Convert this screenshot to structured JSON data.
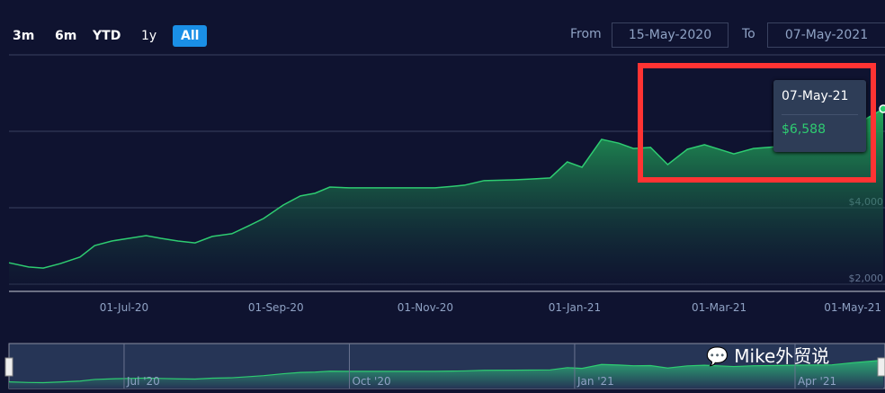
{
  "range_buttons": [
    {
      "label": "3m"
    },
    {
      "label": "6m"
    },
    {
      "label": "YTD"
    },
    {
      "label": "1y"
    },
    {
      "label": "All",
      "active": true
    }
  ],
  "date_range": {
    "from_label": "From",
    "from": "15-May-2020",
    "to_label": "To",
    "to": "07-May-2021"
  },
  "tooltip": {
    "date": "07-May-21",
    "value": "$6,588"
  },
  "watermark": "Mike外贸说",
  "colors": {
    "line": "#2ecc71",
    "highlight_box": "#ff3333",
    "active_button": "#1a8fe6"
  },
  "chart_data": {
    "type": "area",
    "xlim": [
      "2020-05-15",
      "2021-05-07"
    ],
    "ylim": [
      2000,
      8000
    ],
    "y_ticks": [
      {
        "v": 2000,
        "label": "$2,000"
      },
      {
        "v": 4000,
        "label": "$4,000"
      },
      {
        "v": 6000,
        "label": ""
      },
      {
        "v": 8000,
        "label": ""
      }
    ],
    "x_ticks": [
      {
        "d": "2020-07-01",
        "label": "01-Jul-20"
      },
      {
        "d": "2020-09-01",
        "label": "01-Sep-20"
      },
      {
        "d": "2020-11-01",
        "label": "01-Nov-20"
      },
      {
        "d": "2021-01-01",
        "label": "01-Jan-21"
      },
      {
        "d": "2021-03-01",
        "label": "01-Mar-21"
      },
      {
        "d": "2021-05-01",
        "label": "01-May-21"
      }
    ],
    "navigator_ticks": [
      {
        "d": "2020-07-01",
        "label": "Jul '20"
      },
      {
        "d": "2020-10-01",
        "label": "Oct '20"
      },
      {
        "d": "2021-01-01",
        "label": "Jan '21"
      },
      {
        "d": "2021-04-01",
        "label": "Apr '21"
      }
    ],
    "grid": true,
    "points": [
      [
        "2020-05-15",
        2560
      ],
      [
        "2020-05-23",
        2450
      ],
      [
        "2020-05-29",
        2420
      ],
      [
        "2020-06-05",
        2540
      ],
      [
        "2020-06-13",
        2710
      ],
      [
        "2020-06-19",
        3010
      ],
      [
        "2020-06-26",
        3130
      ],
      [
        "2020-07-03",
        3200
      ],
      [
        "2020-07-10",
        3270
      ],
      [
        "2020-07-16",
        3200
      ],
      [
        "2020-07-23",
        3130
      ],
      [
        "2020-07-30",
        3080
      ],
      [
        "2020-08-06",
        3250
      ],
      [
        "2020-08-14",
        3320
      ],
      [
        "2020-08-21",
        3530
      ],
      [
        "2020-08-27",
        3720
      ],
      [
        "2020-09-04",
        4070
      ],
      [
        "2020-09-11",
        4310
      ],
      [
        "2020-09-17",
        4380
      ],
      [
        "2020-09-23",
        4540
      ],
      [
        "2020-10-01",
        4520
      ],
      [
        "2020-10-10",
        4520
      ],
      [
        "2020-10-25",
        4520
      ],
      [
        "2020-11-05",
        4520
      ],
      [
        "2020-11-12",
        4560
      ],
      [
        "2020-11-17",
        4590
      ],
      [
        "2020-11-25",
        4710
      ],
      [
        "2020-12-07",
        4730
      ],
      [
        "2020-12-14",
        4750
      ],
      [
        "2020-12-22",
        4780
      ],
      [
        "2020-12-29",
        5200
      ],
      [
        "2021-01-04",
        5060
      ],
      [
        "2021-01-12",
        5790
      ],
      [
        "2021-01-19",
        5690
      ],
      [
        "2021-01-25",
        5550
      ],
      [
        "2021-02-01",
        5580
      ],
      [
        "2021-02-08",
        5130
      ],
      [
        "2021-02-16",
        5530
      ],
      [
        "2021-02-23",
        5650
      ],
      [
        "2021-03-02",
        5510
      ],
      [
        "2021-03-07",
        5410
      ],
      [
        "2021-03-15",
        5550
      ],
      [
        "2021-03-25",
        5600
      ],
      [
        "2021-04-05",
        5680
      ],
      [
        "2021-04-16",
        5720
      ],
      [
        "2021-04-25",
        6140
      ],
      [
        "2021-05-07",
        6588
      ]
    ]
  }
}
